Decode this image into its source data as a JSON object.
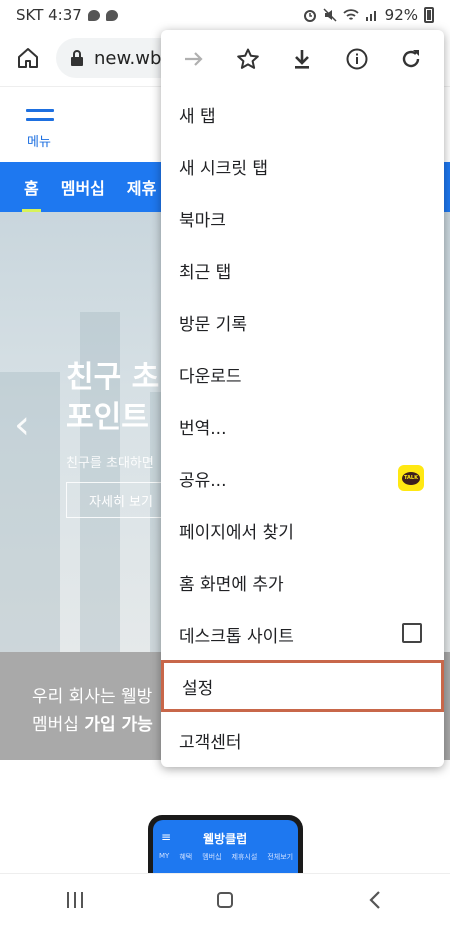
{
  "status_bar": {
    "carrier_time": "SKT 4:37",
    "battery": "92%"
  },
  "url_bar": {
    "url": "new.wb"
  },
  "site": {
    "menu_label": "메뉴",
    "nav": [
      "홈",
      "멤버십",
      "제휴"
    ],
    "hero_title_line1": "친구 초",
    "hero_title_line2": "포인트",
    "hero_sub": "친구를 초대하면",
    "hero_button": "자세히 보기",
    "band_line1": "우리 회사는 웰방",
    "band_line2_prefix": "멤버십 ",
    "band_line2_bold": "가입 가능",
    "phone_logo": "웰방클럽",
    "phone_tabs": [
      "MY",
      "혜택",
      "멤버십",
      "제휴시설",
      "전체보기"
    ]
  },
  "chrome_menu": {
    "toolbar_icons": [
      "forward-icon",
      "star-icon",
      "download-icon",
      "info-icon",
      "refresh-icon"
    ],
    "items": [
      {
        "label": "새 탭"
      },
      {
        "label": "새 시크릿 탭"
      },
      {
        "label": "북마크"
      },
      {
        "label": "최근 탭"
      },
      {
        "label": "방문 기록"
      },
      {
        "label": "다운로드"
      },
      {
        "label": "번역..."
      },
      {
        "label": "공유..."
      },
      {
        "label": "페이지에서 찾기"
      },
      {
        "label": "홈 화면에 추가"
      },
      {
        "label": "데스크톱 사이트"
      },
      {
        "label": "설정"
      },
      {
        "label": "고객센터"
      }
    ],
    "kakao_label": "TALK",
    "desktop_site_checked": false,
    "highlighted_item": "설정",
    "highlight_color": "#c8674a"
  },
  "colors": {
    "site_blue": "#1e78f0",
    "nav_underline": "#d8f25a"
  }
}
